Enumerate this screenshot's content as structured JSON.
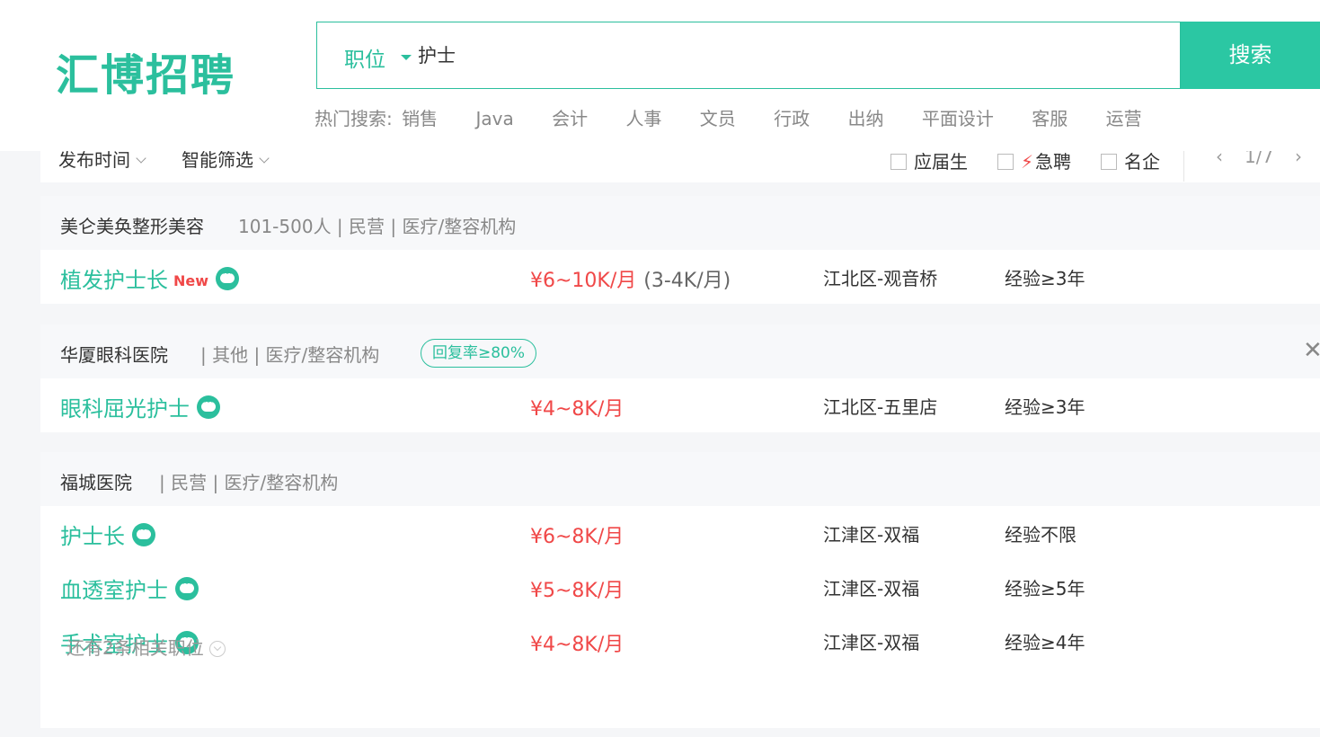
{
  "header": {
    "logo": "汇博招聘",
    "search_type": "职位",
    "search_value": "护士",
    "search_button": "搜索",
    "hot_label": "热门搜索:",
    "hot_terms": [
      "销售",
      "Java",
      "会计",
      "人事",
      "文员",
      "行政",
      "出纳",
      "平面设计",
      "客服",
      "运营"
    ]
  },
  "filter": {
    "publish_time": "发布时间",
    "smart_filter": "智能筛选",
    "fresh_grad": "应届生",
    "urgent": "急聘",
    "famous": "名企",
    "page": "1/7"
  },
  "companies": [
    {
      "name": "美仑美奂整形美容",
      "info": "101-500人 | 民营 | 医疗/整容机构",
      "jobs": [
        {
          "title": "植发护士长",
          "tag": "New",
          "salary": "¥6~10K/月",
          "salary_sub": "(3-4K/月)",
          "location": "江北区-观音桥",
          "experience": "经验≥3年"
        }
      ]
    },
    {
      "name": "华厦眼科医院",
      "info": "| 其他 | 医疗/整容机构",
      "badge": "回复率≥80%",
      "jobs": [
        {
          "title": "眼科屈光护士",
          "salary": "¥4~8K/月",
          "location": "江北区-五里店",
          "experience": "经验≥3年"
        }
      ]
    },
    {
      "name": "福城医院",
      "info": "| 民营 | 医疗/整容机构",
      "jobs": [
        {
          "title": "护士长",
          "salary": "¥6~8K/月",
          "location": "江津区-双福",
          "experience": "经验不限"
        },
        {
          "title": "血透室护士",
          "salary": "¥5~8K/月",
          "location": "江津区-双福",
          "experience": "经验≥5年"
        },
        {
          "title": "手术室护士",
          "salary": "¥4~8K/月",
          "location": "江津区-双福",
          "experience": "经验≥4年"
        }
      ],
      "more": "还有2条相关职位"
    }
  ],
  "colors": {
    "accent": "#2bbf9d",
    "salary": "#f04848"
  }
}
